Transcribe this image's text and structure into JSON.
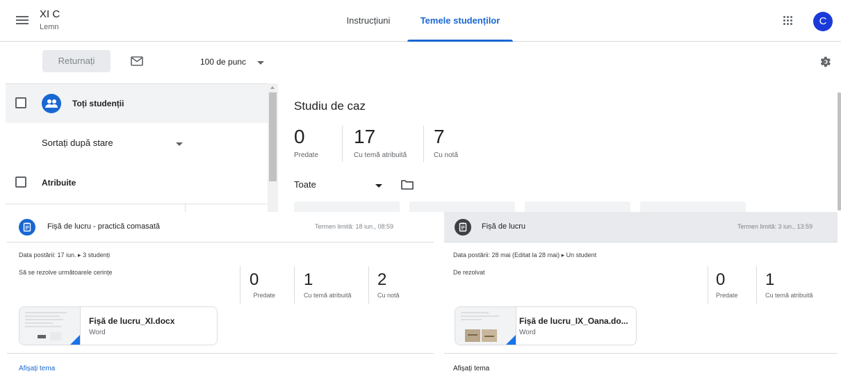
{
  "header": {
    "class_name": "XI C",
    "class_section": "Lemn",
    "tabs": [
      {
        "label": "Instrucțiuni"
      },
      {
        "label": "Temele studenților"
      }
    ],
    "avatar_letter": "C",
    "accent_color": "#1967d2"
  },
  "toolbar": {
    "return_label": "Returnați",
    "points_value": "100 de punc"
  },
  "student_list": {
    "all_students_label": "Toți studenții",
    "sort_label": "Sortați după stare",
    "group_assigned_label": "Atribuite"
  },
  "assignment": {
    "title": "Studiu de caz",
    "stats": [
      {
        "value": "0",
        "label": "Predate"
      },
      {
        "value": "17",
        "label": "Cu temă atribuită"
      },
      {
        "value": "7",
        "label": "Cu notă"
      }
    ],
    "filter_label": "Toate"
  },
  "cards": [
    {
      "title": "Fișă de lucru - practică comasată",
      "due": "Termen limită: 18 iun., 08:59",
      "meta": "Data postării: 17 iun.  ▸ 3 studenți",
      "description": "Să se rezolve următoarele cerințe",
      "stats": [
        {
          "value": "0",
          "label": "Predate"
        },
        {
          "value": "1",
          "label": "Cu temă atribuită"
        },
        {
          "value": "2",
          "label": "Cu notă"
        }
      ],
      "attachment": {
        "name": "Fișă de lucru_XI.docx",
        "type": "Word"
      },
      "show_label": "Afișați tema",
      "icon_color": "#1967d2"
    },
    {
      "title": "Fișă de lucru",
      "due": "Termen limită: 3 iun., 13:59",
      "meta": "Data postării: 28 mai (Editat la 28 mai)  ▸ Un student",
      "description": "De rezolvat",
      "stats": [
        {
          "value": "0",
          "label": "Predate"
        },
        {
          "value": "1",
          "label": "Cu temă atribuită"
        }
      ],
      "attachment": {
        "name": "Fișă de lucru_IX_Oana.do...",
        "type": "Word"
      },
      "show_label": "Afișați tema",
      "icon_color": "#3c4043"
    }
  ]
}
